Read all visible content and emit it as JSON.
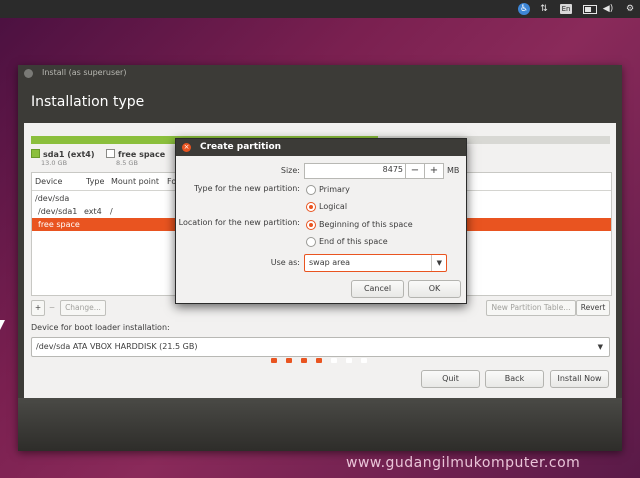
{
  "top_panel": {
    "accessibility_icon": "accessibility-icon",
    "network_icon": "network-arrows-icon",
    "keyboard_layout": "En",
    "battery_icon": "battery-icon",
    "volume_icon": "volume-icon",
    "settings_icon": "gear-icon"
  },
  "window": {
    "title": "Install (as superuser)",
    "header": "Installation type"
  },
  "disk": {
    "used_fraction": 0.6,
    "legend": [
      {
        "name": "sda1 (ext4)",
        "size": "13.0 GB",
        "color": "#8bbf3c"
      },
      {
        "name": "free space",
        "size": "8.5 GB",
        "color": "#ffffff"
      }
    ]
  },
  "table": {
    "columns": [
      "Device",
      "Type",
      "Mount point",
      "Fo"
    ],
    "rows": [
      {
        "device": "/dev/sda",
        "type": "",
        "mount": ""
      },
      {
        "device": "/dev/sda1",
        "type": "ext4",
        "mount": "/"
      },
      {
        "device": "free space",
        "type": "",
        "mount": "",
        "selected": true
      }
    ]
  },
  "table_buttons": {
    "add": "+",
    "remove": "−",
    "change": "Change...",
    "new_table": "New Partition Table...",
    "revert": "Revert"
  },
  "boot_loader": {
    "label": "Device for boot loader installation:",
    "value": "/dev/sda   ATA VBOX HARDDISK (21.5 GB)"
  },
  "nav_buttons": {
    "quit": "Quit",
    "back": "Back",
    "install": "Install Now"
  },
  "progress_dots": {
    "total": 7,
    "completed": 4,
    "colors": {
      "done": "#e95420",
      "todo": "#ffffff"
    }
  },
  "dialog": {
    "title": "Create partition",
    "size_label": "Size:",
    "size_value": "8475",
    "size_unit": "MB",
    "size_minus": "−",
    "size_plus": "+",
    "type_label": "Type for the new partition:",
    "type_options": [
      "Primary",
      "Logical"
    ],
    "type_selected": "Logical",
    "location_label": "Location for the new partition:",
    "location_options": [
      "Beginning of this space",
      "End of this space"
    ],
    "location_selected": "Beginning of this space",
    "use_as_label": "Use as:",
    "use_as_value": "swap area",
    "cancel": "Cancel",
    "ok": "OK"
  },
  "watermark": "www.gudangilmukomputer.com",
  "accent_color": "#e95420"
}
